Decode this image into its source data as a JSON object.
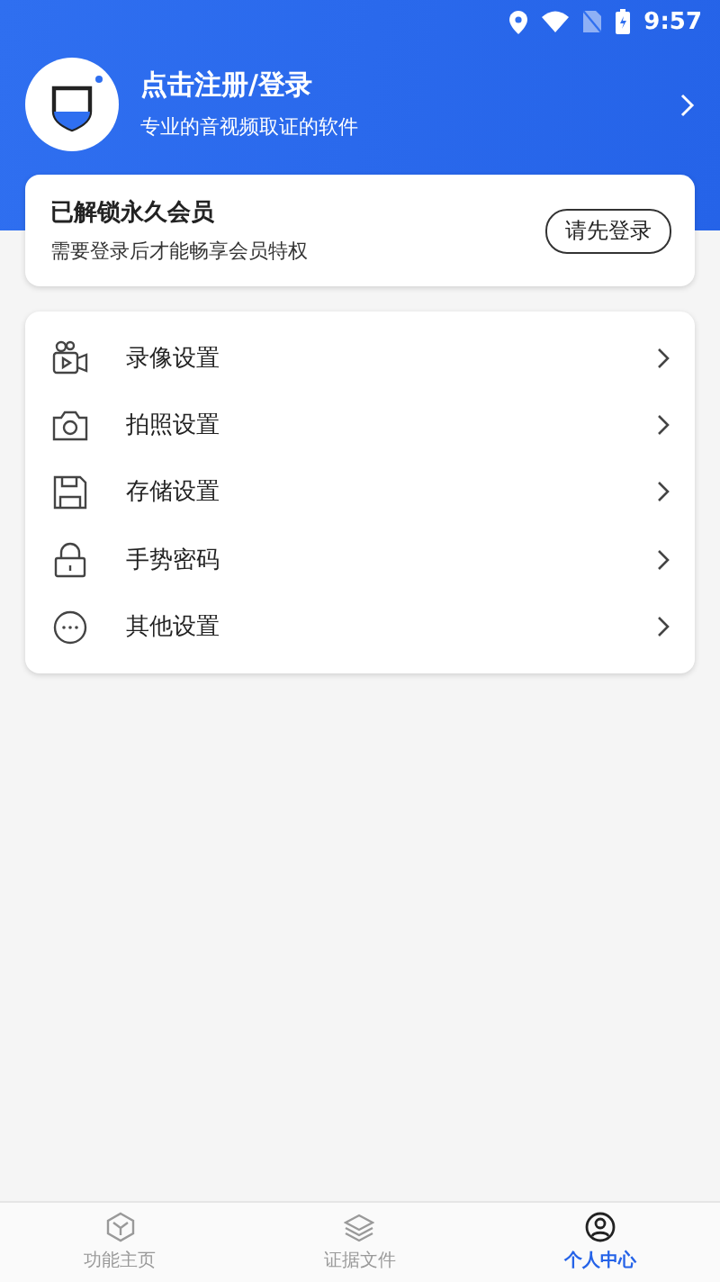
{
  "status_bar": {
    "time": "9:57"
  },
  "profile": {
    "title": "点击注册/登录",
    "subtitle": "专业的音视频取证的软件"
  },
  "membership": {
    "title": "已解锁永久会员",
    "subtitle": "需要登录后才能畅享会员特权",
    "button": "请先登录"
  },
  "menu": [
    {
      "kind": "video",
      "label": "录像设置"
    },
    {
      "kind": "camera",
      "label": "拍照设置"
    },
    {
      "kind": "storage",
      "label": "存储设置"
    },
    {
      "kind": "lock",
      "label": "手势密码"
    },
    {
      "kind": "more",
      "label": "其他设置"
    }
  ],
  "bottom_nav": [
    {
      "kind": "cube",
      "label": "功能主页",
      "selected": false
    },
    {
      "kind": "layers",
      "label": "证据文件",
      "selected": false
    },
    {
      "kind": "user",
      "label": "个人中心",
      "selected": true
    }
  ]
}
